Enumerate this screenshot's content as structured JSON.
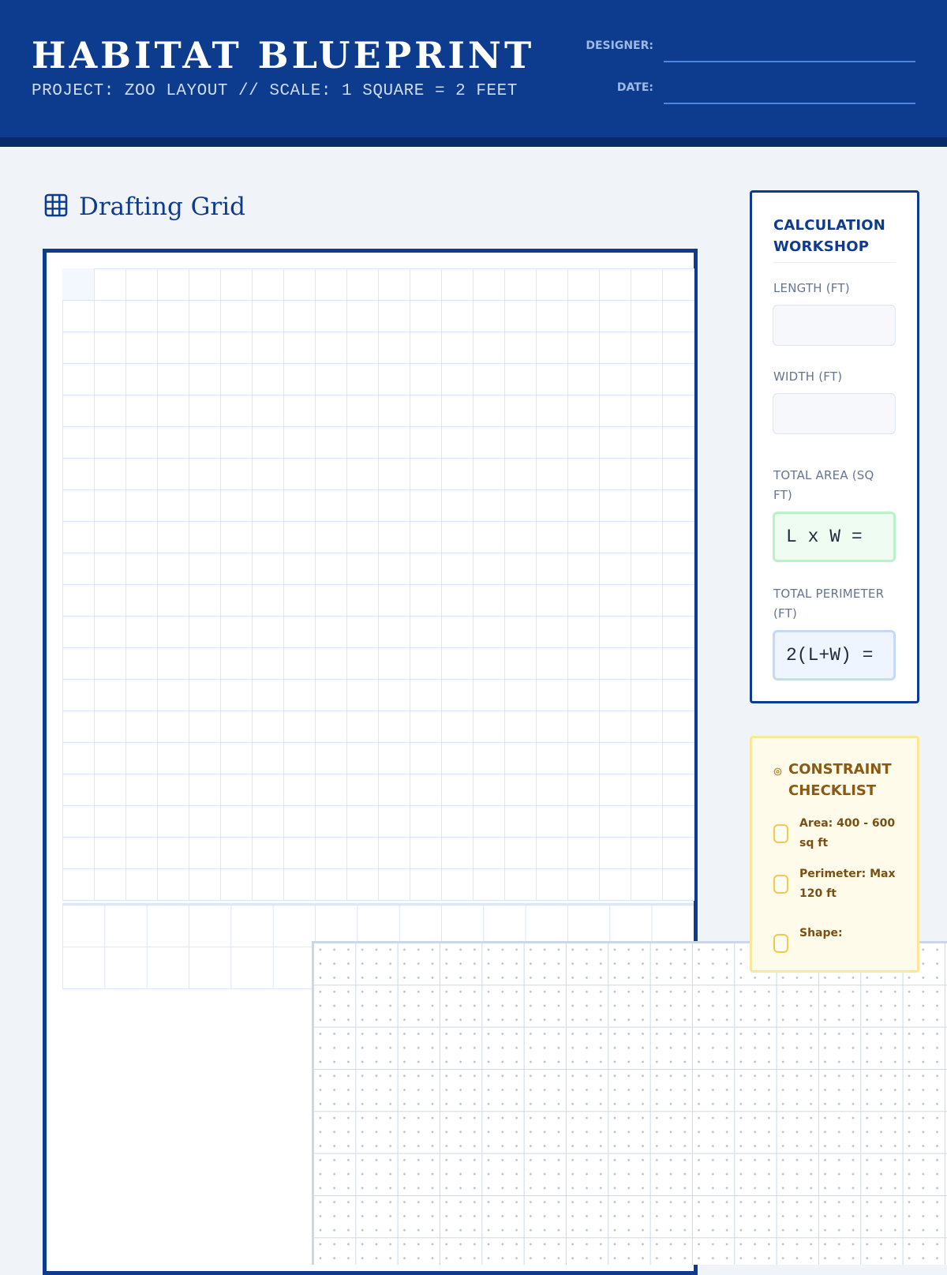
{
  "header": {
    "title": "HABITAT BLUEPRINT",
    "subtitle": "PROJECT: ZOO LAYOUT // SCALE: 1 SQUARE = 2 FEET",
    "designer_label": "DESIGNER:",
    "designer_value": "",
    "date_label": "DATE:",
    "date_value": ""
  },
  "drafting": {
    "heading": "Drafting Grid",
    "icon": "grid-icon"
  },
  "calc": {
    "title": "CALCULATION WORKSHOP",
    "length_label": "LENGTH (FT)",
    "length_value": "",
    "width_label": "WIDTH (FT)",
    "width_value": "",
    "area_label": "TOTAL AREA (SQ FT)",
    "area_formula": "L x W =",
    "perimeter_label": "TOTAL PERIMETER (FT)",
    "perimeter_formula": "2(L+W) ="
  },
  "checklist": {
    "title": "CONSTRAINT CHECKLIST",
    "icon": "target-icon",
    "items": [
      {
        "label": "Area: 400 - 600 sq ft",
        "checked": false
      },
      {
        "label": "Perimeter: Max 120 ft",
        "checked": false
      },
      {
        "label": "Shape:",
        "checked": false
      }
    ]
  },
  "colors": {
    "brand_blue": "#0d3b8e",
    "header_dark": "#082a66",
    "area_green": "#b8f2c8",
    "perimeter_blue": "#c4dbf8",
    "checklist_yellow": "#f9e79a"
  }
}
